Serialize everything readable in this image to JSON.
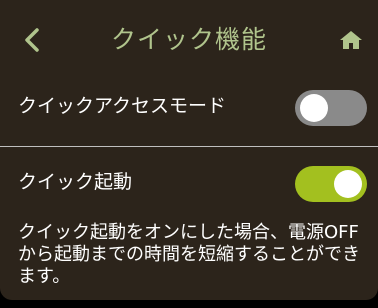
{
  "header": {
    "title": "クイック機能",
    "back_icon": "chevron-left-icon",
    "home_icon": "home-icon"
  },
  "settings": {
    "quick_access_mode": {
      "label": "クイックアクセスモード",
      "enabled": false
    },
    "quick_start": {
      "label": "クイック起動",
      "enabled": true,
      "description": "クイック起動をオンにした場合、電源OFFから起動までの時間を短縮することができます。"
    }
  },
  "colors": {
    "background": "#2c241b",
    "accent": "#b0c48c",
    "toggle_on": "#a3c01f",
    "toggle_off": "#8a8a8a"
  }
}
